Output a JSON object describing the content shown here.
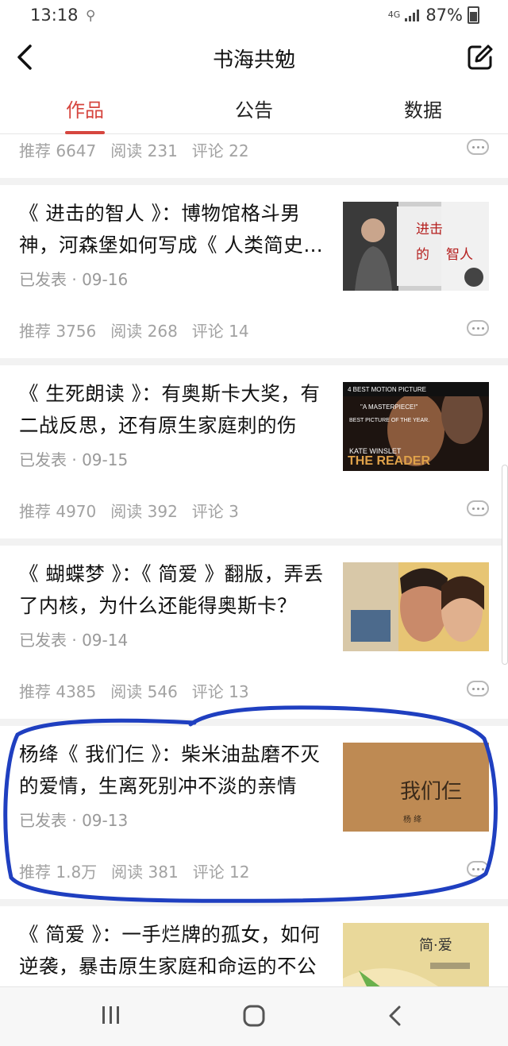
{
  "status_bar": {
    "time": "13:18",
    "network": "4G",
    "battery_percent": "87%"
  },
  "header": {
    "title": "书海共勉",
    "back_icon": "chevron-left-icon",
    "edit_icon": "edit-icon"
  },
  "tabs": [
    {
      "label": "作品",
      "active": true
    },
    {
      "label": "公告",
      "active": false
    },
    {
      "label": "数据",
      "active": false
    }
  ],
  "partial_card": {
    "stats": {
      "recommend": "推荐 6647",
      "read": "阅读 231",
      "comment": "评论 22"
    }
  },
  "articles": [
    {
      "headline": "《 进击的智人 》：博物馆格斗男神，河森堡如何写成《 人类简史…",
      "meta": "已发表 · 09-16",
      "stats": {
        "recommend": "推荐 3756",
        "read": "阅读 268",
        "comment": "评论 14"
      },
      "thumb_text": "进击的智人"
    },
    {
      "headline": "《 生死朗读 》：有奥斯卡大奖，有二战反思，还有原生家庭刺的伤",
      "meta": "已发表 · 09-15",
      "stats": {
        "recommend": "推荐 4970",
        "read": "阅读 392",
        "comment": "评论 3"
      },
      "thumb_text": "THE READER"
    },
    {
      "headline": "《 蝴蝶梦 》：《 简爱 》翻版，弄丢了内核，为什么还能得奥斯卡？",
      "meta": "已发表 · 09-14",
      "stats": {
        "recommend": "推荐 4385",
        "read": "阅读 546",
        "comment": "评论 13"
      },
      "thumb_text": ""
    },
    {
      "headline": "杨绛《 我们仨 》：柴米油盐磨不灭的爱情，生离死别冲不淡的亲情",
      "meta": "已发表 · 09-13",
      "stats": {
        "recommend": "推荐 1.8万",
        "read": "阅读 381",
        "comment": "评论 12"
      },
      "thumb_text": "我们仨",
      "thumb_author": "杨 绛"
    },
    {
      "headline": "《 简爱 》：一手烂牌的孤女，如何逆袭，暴击原生家庭和命运的不公",
      "meta": "",
      "stats": {},
      "thumb_text": "简·爱"
    }
  ],
  "nav_bar": {
    "recent_icon": "recent-apps-icon",
    "home_icon": "home-icon",
    "back_icon": "back-icon"
  },
  "colors": {
    "accent": "#d6463f",
    "annotation": "#1f3fc0"
  }
}
